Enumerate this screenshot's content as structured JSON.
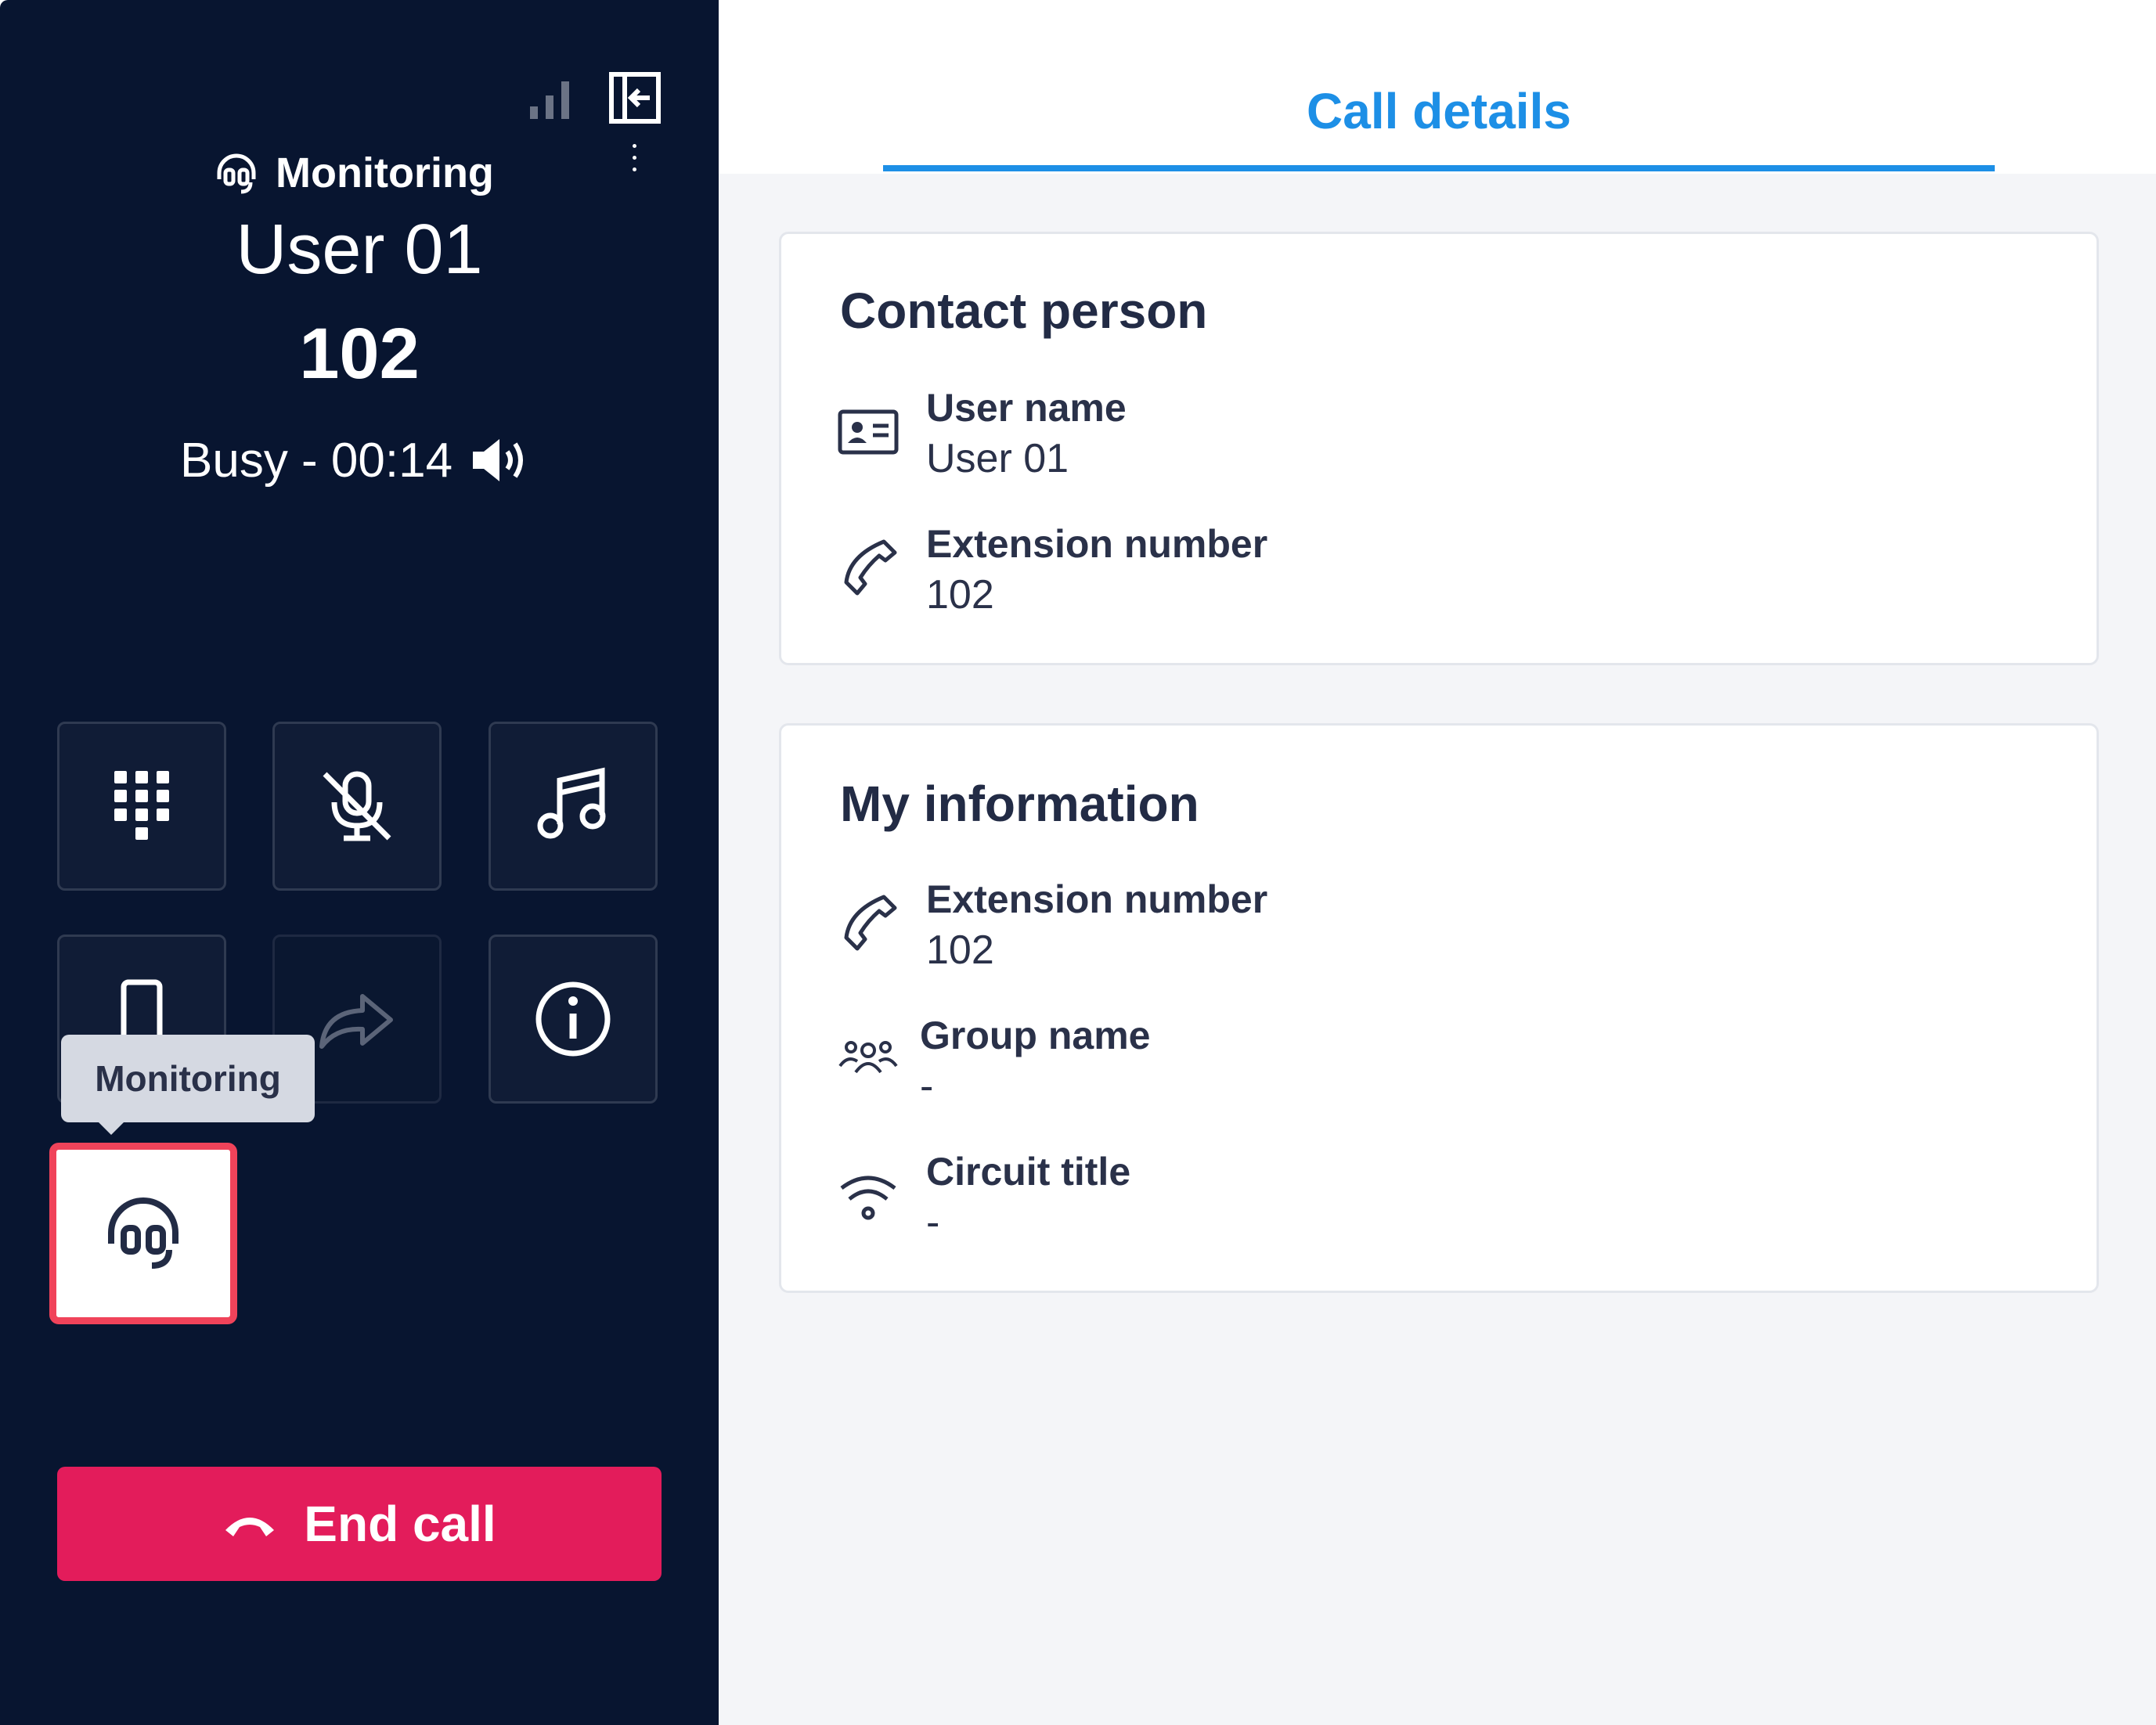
{
  "sidebar": {
    "mode_label": "Monitoring",
    "user_name": "User 01",
    "extension": "102",
    "status": "Busy - 00:14",
    "controls": [
      {
        "icon": "dialpad-icon"
      },
      {
        "icon": "mic-off-icon"
      },
      {
        "icon": "music-note-icon"
      },
      {
        "icon": "mobile-phone-icon"
      },
      {
        "icon": "forward-arrow-icon"
      },
      {
        "icon": "info-icon"
      },
      {
        "icon": "headset-icon"
      }
    ],
    "tooltip": "Monitoring",
    "end_call_label": "End call"
  },
  "tab": {
    "label": "Call details"
  },
  "contact_person": {
    "title": "Contact person",
    "user_name_label": "User name",
    "user_name_value": "User 01",
    "extension_label": "Extension number",
    "extension_value": "102"
  },
  "my_information": {
    "title": "My information",
    "extension_label": "Extension number",
    "extension_value": "102",
    "group_label": "Group name",
    "group_value": "-",
    "circuit_label": "Circuit title",
    "circuit_value": "-"
  },
  "colors": {
    "sidebar_bg": "#081530",
    "accent_blue": "#1d8fe6",
    "end_call_red": "#e31c5b",
    "highlight_border": "#f0435a"
  }
}
